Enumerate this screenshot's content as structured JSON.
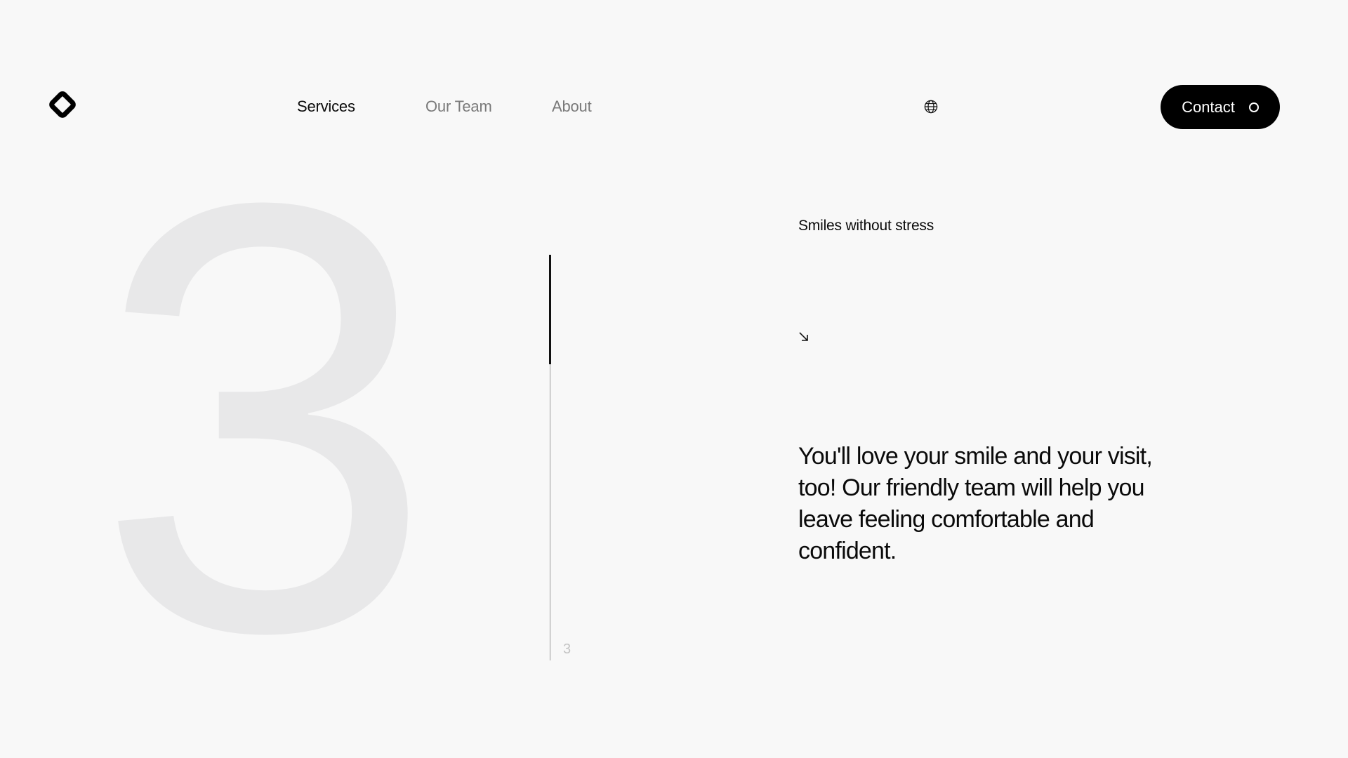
{
  "header": {
    "logo_icon": "diamond-logo-icon",
    "nav": {
      "services": "Services",
      "team": "Our Team",
      "about": "About"
    },
    "language_icon": "globe-icon",
    "contact_label": "Contact"
  },
  "hero": {
    "big_number": "3",
    "slide_index": "3",
    "progress_fraction": 0.27,
    "eyebrow": "Smiles without stress",
    "arrow_icon": "arrow-down-right-icon",
    "headline": "You'll love your smile and your visit, too! Our friendly team will help you leave feeling comfortable and confident."
  },
  "colors": {
    "background": "#f8f8f8",
    "text": "#0a0a0a",
    "muted_nav": "#7a7a7a",
    "big_number": "#e8e8e9",
    "button_bg": "#000000"
  }
}
